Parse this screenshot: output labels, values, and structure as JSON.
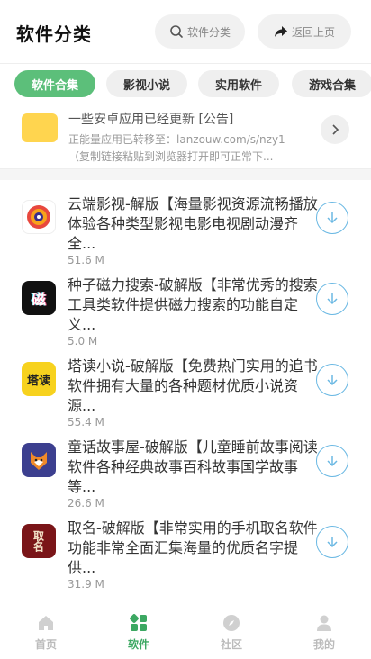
{
  "header": {
    "title": "软件分类",
    "search_label": "软件分类",
    "back_label": "返回上页"
  },
  "tabs": [
    {
      "label": "软件合集",
      "active": true
    },
    {
      "label": "影视小说",
      "active": false
    },
    {
      "label": "实用软件",
      "active": false
    },
    {
      "label": "游戏合集",
      "active": false
    }
  ],
  "notice": {
    "title": "一些安卓应用已经更新 [公告]",
    "line1": "正能量应用已转移至：lanzouw.com/s/nzy1",
    "line2": "（复制链接粘贴到浏览器打开即可正常下..."
  },
  "apps": [
    {
      "text": "云端影视-解版【海量影视资源流畅播放体验各种类型影视电影电视剧动漫齐全...",
      "size": "51.6 M",
      "icon_label": "",
      "icon_color": "#ffffff"
    },
    {
      "text": "种子磁力搜索-破解版【非常优秀的搜索工具类软件提供磁力搜索的功能自定义...",
      "size": "5.0 M",
      "icon_label": "磁",
      "icon_color": "#111111"
    },
    {
      "text": "塔读小说-破解版【免费热门实用的追书软件拥有大量的各种题材优质小说资源...",
      "size": "55.4 M",
      "icon_label": "塔读",
      "icon_color": "#f7d21e"
    },
    {
      "text": "童话故事屋-破解版【儿童睡前故事阅读软件各种经典故事百科故事国学故事等...",
      "size": "26.6 M",
      "icon_label": "",
      "icon_color": "#3c3f8f"
    },
    {
      "text": "取名-破解版【非常实用的手机取名软件功能非常全面汇集海量的优质名字提供...",
      "size": "31.9 M",
      "icon_label": "取名",
      "icon_color": "#7a1518"
    }
  ],
  "nav": [
    {
      "label": "首页",
      "icon": "home-icon",
      "active": false
    },
    {
      "label": "软件",
      "icon": "apps-icon",
      "active": true
    },
    {
      "label": "社区",
      "icon": "compass-icon",
      "active": false
    },
    {
      "label": "我的",
      "icon": "user-icon",
      "active": false
    }
  ],
  "colors": {
    "accent": "#5cbf7a",
    "nav_active": "#3ca862",
    "download": "#6ab8e3"
  }
}
